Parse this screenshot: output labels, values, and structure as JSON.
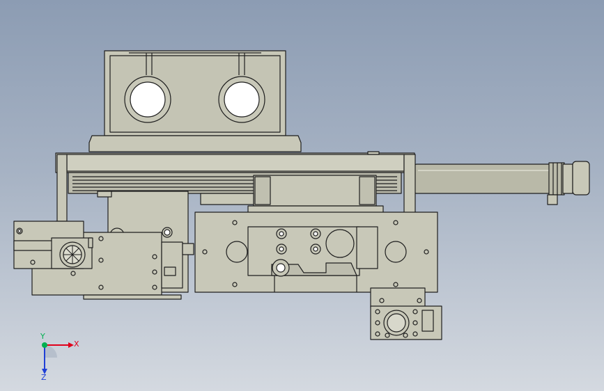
{
  "viewport": {
    "background_top": "#8c9cb3",
    "background_bottom": "#d4d9e0",
    "part_fill": "#c8c8b8",
    "part_stroke": "#1e1e1e"
  },
  "triad": {
    "x_label": "X",
    "y_label": "Y",
    "z_label": "Z",
    "x_color": "#e0001b",
    "y_color": "#00b050",
    "z_color": "#1f3fd6"
  }
}
